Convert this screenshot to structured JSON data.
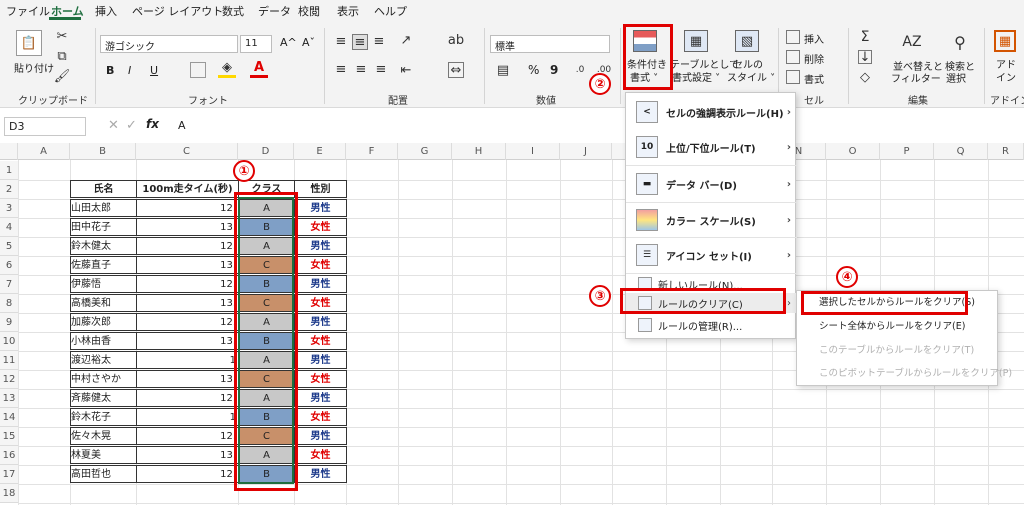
{
  "menu_tabs": [
    "ファイル",
    "ホーム",
    "挿入",
    "ページ レイアウト",
    "数式",
    "データ",
    "校閲",
    "表示",
    "ヘルプ"
  ],
  "ribbon": {
    "clipboard": {
      "paste": "貼り付け",
      "group": "クリップボード"
    },
    "font": {
      "name": "游ゴシック",
      "size": "11",
      "bold": "B",
      "italic": "I",
      "underline": "U",
      "grow": "A^",
      "shrink": "Aˇ",
      "fill_icon": "paint-bucket-icon",
      "color_icon": "font-color-icon",
      "group": "フォント"
    },
    "align": {
      "group": "配置"
    },
    "number": {
      "format": "標準",
      "percent": "%",
      "comma": "9",
      "group": "数値"
    },
    "styles": {
      "conditional": "条件付き\n書式",
      "conditional_line1": "条件付き",
      "conditional_line2": "書式 ˅",
      "table": "テーブルとして",
      "table_line2": "書式設定 ˅",
      "cell_style_line1": "セルの",
      "cell_style_line2": "スタイル ˅"
    },
    "cells": {
      "insert": "挿入",
      "delete": "削除",
      "format": "書式",
      "group": "セル"
    },
    "editing": {
      "sort_line1": "並べ替えと",
      "sort_line2": "フィルター",
      "find_line1": "検索と",
      "find_line2": "選択",
      "group": "編集"
    },
    "addin": {
      "line1": "アド",
      "line2": "イン",
      "group": "アドイン"
    }
  },
  "formula_bar": {
    "namebox": "D3",
    "fx": "fx",
    "content": "A"
  },
  "columns": [
    "A",
    "B",
    "C",
    "D",
    "E",
    "F",
    "G",
    "H",
    "I",
    "J",
    "K",
    "L",
    "M",
    "N",
    "O",
    "P",
    "Q",
    "R"
  ],
  "rows": [
    "1",
    "2",
    "3",
    "4",
    "5",
    "6",
    "7",
    "8",
    "9",
    "10",
    "11",
    "12",
    "13",
    "14",
    "15",
    "16",
    "17",
    "18"
  ],
  "table": {
    "headers": [
      "氏名",
      "100m走タイム(秒)",
      "クラス",
      "性別"
    ],
    "rows": [
      {
        "name": "山田太郎",
        "time": "12.",
        "cls": "A",
        "sex": "男性"
      },
      {
        "name": "田中花子",
        "time": "13.",
        "cls": "B",
        "sex": "女性"
      },
      {
        "name": "鈴木健太",
        "time": "12.",
        "cls": "A",
        "sex": "男性"
      },
      {
        "name": "佐藤直子",
        "time": "13.",
        "cls": "C",
        "sex": "女性"
      },
      {
        "name": "伊藤悟",
        "time": "12.",
        "cls": "B",
        "sex": "男性"
      },
      {
        "name": "高橋美和",
        "time": "13.",
        "cls": "C",
        "sex": "女性"
      },
      {
        "name": "加藤次郎",
        "time": "12.",
        "cls": "A",
        "sex": "男性"
      },
      {
        "name": "小林由香",
        "time": "13.",
        "cls": "B",
        "sex": "女性"
      },
      {
        "name": "渡辺裕太",
        "time": "1",
        "cls": "A",
        "sex": "男性"
      },
      {
        "name": "中村さやか",
        "time": "13.",
        "cls": "C",
        "sex": "女性"
      },
      {
        "name": "斉藤健太",
        "time": "12.",
        "cls": "A",
        "sex": "男性"
      },
      {
        "name": "鈴木花子",
        "time": "1",
        "cls": "B",
        "sex": "女性"
      },
      {
        "name": "佐々木晃",
        "time": "12.",
        "cls": "C",
        "sex": "男性"
      },
      {
        "name": "林夏美",
        "time": "13.",
        "cls": "A",
        "sex": "女性"
      },
      {
        "name": "高田哲也",
        "time": "12.",
        "cls": "B",
        "sex": "男性"
      }
    ]
  },
  "colors": {
    "A": "#c8c8c8",
    "B": "#7f9fc6",
    "C": "#c8906a",
    "accent": "#e00000",
    "excel_green": "#1e6e3f"
  },
  "cf_menu": {
    "items": [
      "セルの強調表示ルール(H)",
      "上位/下位ルール(T)",
      "データ バー(D)",
      "カラー スケール(S)",
      "アイコン セット(I)"
    ],
    "new_rule": "新しいルール(N)...",
    "clear_rule": "ルールのクリア(C)",
    "manage_rule": "ルールの管理(R)..."
  },
  "clear_submenu": {
    "items": [
      "選択したセルからルールをクリア(S)",
      "シート全体からルールをクリア(E)",
      "このテーブルからルールをクリア(T)",
      "このピボットテーブルからルールをクリア(P)"
    ]
  },
  "steps": [
    "①",
    "②",
    "③",
    "④"
  ]
}
